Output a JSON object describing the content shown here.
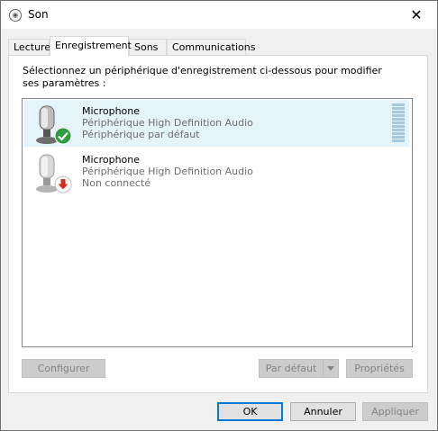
{
  "window": {
    "title": "Son",
    "close_glyph": "✕"
  },
  "tabs": [
    {
      "label": "Lecture"
    },
    {
      "label": "Enregistrement"
    },
    {
      "label": "Sons"
    },
    {
      "label": "Communications"
    }
  ],
  "instruction": "Sélectionnez un périphérique d'enregistrement ci-dessous pour modifier ses paramètres :",
  "devices": [
    {
      "name": "Microphone",
      "driver": "Périphérique High Definition Audio",
      "status": "Périphérique par défaut",
      "status_icon": "green-check-icon",
      "selected": true
    },
    {
      "name": "Microphone",
      "driver": "Périphérique High Definition Audio",
      "status": "Non connecté",
      "status_icon": "red-down-arrow-icon",
      "selected": false
    }
  ],
  "panel_buttons": {
    "configure": "Configurer",
    "set_default": "Par défaut",
    "properties": "Propriétés"
  },
  "dialog_buttons": {
    "ok": "OK",
    "cancel": "Annuler",
    "apply": "Appliquer"
  },
  "colors": {
    "selection": "#e5f3fb",
    "accent": "#0078d7",
    "check_green": "#2e9b3e",
    "arrow_red": "#d82c20"
  }
}
